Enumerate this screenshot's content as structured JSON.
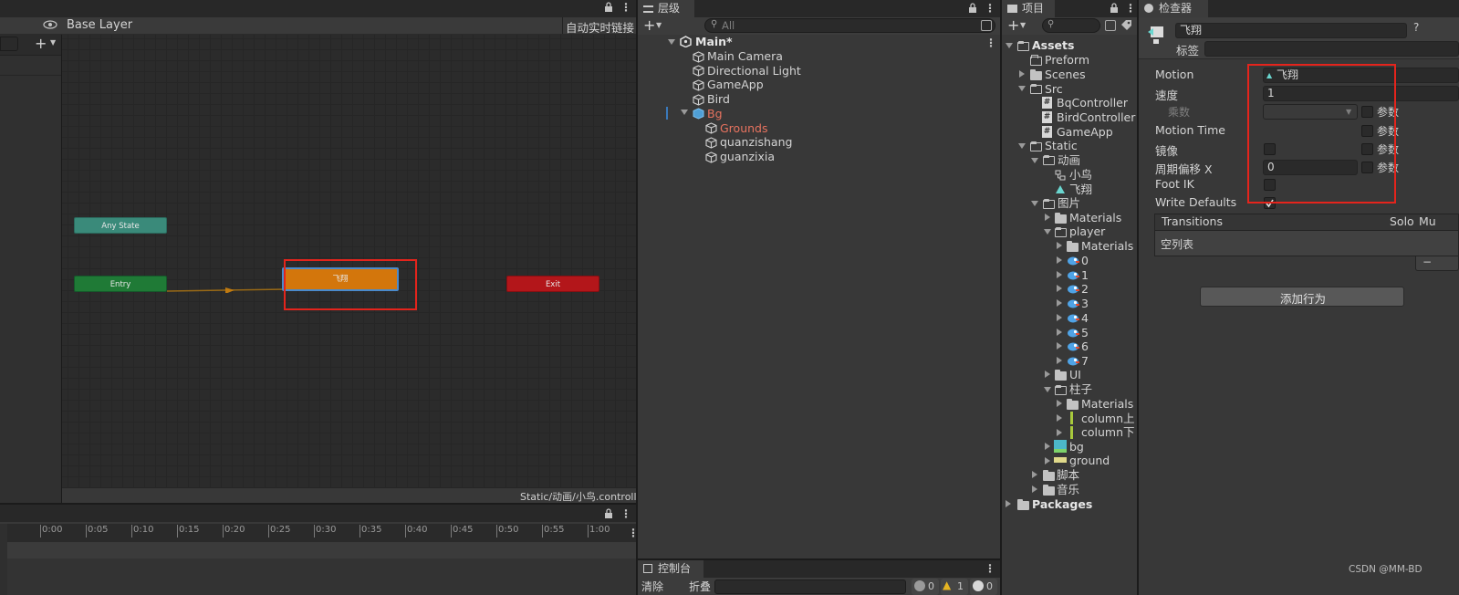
{
  "animator": {
    "layer_name": "Base Layer",
    "live_link": "自动实时链接",
    "footer_path": "Static/动画/小鸟.controller",
    "nodes": {
      "any_state": "Any State",
      "entry": "Entry",
      "state": "飞翔",
      "exit": "Exit"
    }
  },
  "timeline": {
    "ticks": [
      "0:00",
      "0:05",
      "0:10",
      "0:15",
      "0:20",
      "0:25",
      "0:30",
      "0:35",
      "0:40",
      "0:45",
      "0:50",
      "0:55",
      "1:00"
    ]
  },
  "hierarchy": {
    "tab_label": "层级",
    "search_placeholder": "All",
    "scene": "Main*",
    "items": [
      {
        "label": "Main Camera"
      },
      {
        "label": "Directional Light"
      },
      {
        "label": "GameApp"
      },
      {
        "label": "Bird"
      },
      {
        "label": "Bg"
      },
      {
        "label": "Grounds"
      },
      {
        "label": "quanzishang"
      },
      {
        "label": "guanzixia"
      }
    ]
  },
  "project": {
    "tab_label": "项目",
    "items": [
      {
        "label": "Assets"
      },
      {
        "label": "Preform"
      },
      {
        "label": "Scenes"
      },
      {
        "label": "Src"
      },
      {
        "label": "BqController"
      },
      {
        "label": "BirdController"
      },
      {
        "label": "GameApp"
      },
      {
        "label": "Static"
      },
      {
        "label": "动画"
      },
      {
        "label": "小鸟"
      },
      {
        "label": "飞翔"
      },
      {
        "label": "图片"
      },
      {
        "label": "Materials"
      },
      {
        "label": "player"
      },
      {
        "label": "Materials"
      },
      {
        "label": "0"
      },
      {
        "label": "1"
      },
      {
        "label": "2"
      },
      {
        "label": "3"
      },
      {
        "label": "4"
      },
      {
        "label": "5"
      },
      {
        "label": "6"
      },
      {
        "label": "7"
      },
      {
        "label": "UI"
      },
      {
        "label": "柱子"
      },
      {
        "label": "Materials"
      },
      {
        "label": "column上"
      },
      {
        "label": "column下"
      },
      {
        "label": "bg"
      },
      {
        "label": "ground"
      },
      {
        "label": "脚本"
      },
      {
        "label": "音乐"
      },
      {
        "label": "Packages"
      }
    ]
  },
  "inspector": {
    "tab_label": "检查器",
    "object_name": "飞翔",
    "tag_label": "标签",
    "motion_label": "Motion",
    "motion_value": "飞翔",
    "speed_label": "速度",
    "speed_value": "1",
    "multiplier_label": "乘数",
    "motion_time_label": "Motion Time",
    "mirror_label": "镜像",
    "cycle_offset_label": "周期偏移 X",
    "cycle_offset_value": "0",
    "foot_ik_label": "Foot IK",
    "write_defaults_label": "Write Defaults",
    "param_label": "参数",
    "transitions_label": "Transitions",
    "solo_label": "Solo",
    "mute_label": "Mu",
    "empty_list": "空列表",
    "add_behaviour": "添加行为",
    "remove_button": "−"
  },
  "console": {
    "tab_label": "控制台",
    "clear_label": "清除",
    "collapse_label": "折叠",
    "counts": [
      "0",
      "1",
      "0"
    ]
  },
  "watermark": "CSDN @MM-BD",
  "colors": {
    "any_state": "#3a8a7a",
    "entry": "#1f7a36",
    "state": "#d3760c",
    "exit": "#b3161a",
    "highlight": "#e4241c",
    "selected_red": "#e8735f"
  }
}
